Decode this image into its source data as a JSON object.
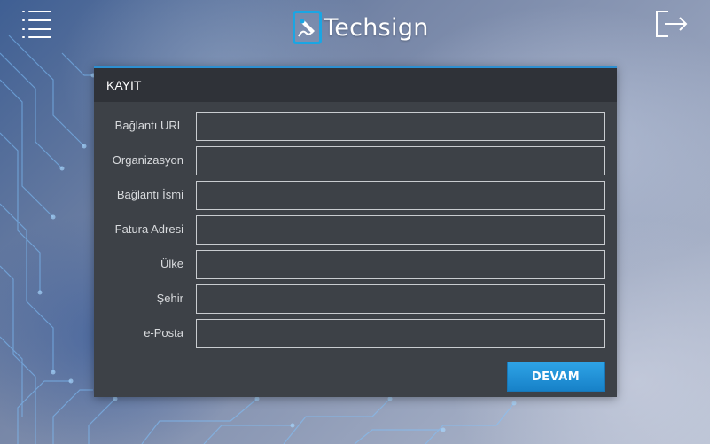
{
  "header": {
    "logo_text": "Techsign",
    "logo_icon": "pen-signature-icon",
    "menu_icon": "hamburger-menu-icon",
    "logout_icon": "logout-icon"
  },
  "form": {
    "title": "KAYIT",
    "fields": [
      {
        "label": "Bağlantı URL",
        "value": ""
      },
      {
        "label": "Organizasyon",
        "value": ""
      },
      {
        "label": "Bağlantı İsmi",
        "value": ""
      },
      {
        "label": "Fatura Adresi",
        "value": ""
      },
      {
        "label": "Ülke",
        "value": ""
      },
      {
        "label": "Şehir",
        "value": ""
      },
      {
        "label": "e-Posta",
        "value": ""
      }
    ],
    "submit_label": "DEVAM"
  },
  "colors": {
    "accent": "#2d8fd0",
    "button": "#1e8fd6",
    "panel": "#3d4147",
    "panel_header": "#2f3238"
  }
}
